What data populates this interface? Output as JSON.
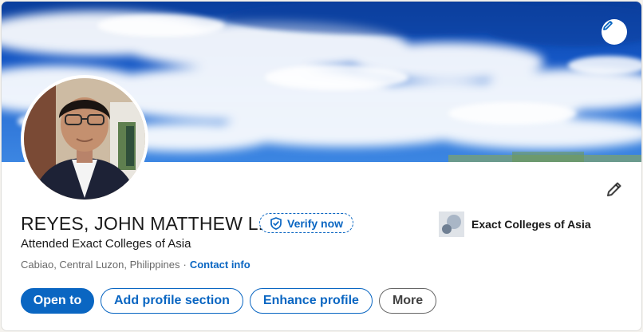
{
  "profile": {
    "name": "REYES, JOHN MATTHEW L.",
    "verify_label": "Verify now",
    "headline": "Attended Exact Colleges of Asia",
    "location": "Cabiao, Central Luzon, Philippines",
    "separator": "·",
    "contact_label": "Contact info"
  },
  "education": {
    "name": "Exact Colleges of Asia"
  },
  "actions": {
    "open_to": "Open to",
    "add_section": "Add profile section",
    "enhance": "Enhance profile",
    "more": "More"
  },
  "icons": {
    "edit_banner": "pencil-icon",
    "edit_intro": "pencil-icon",
    "verify": "shield-check-icon"
  },
  "colors": {
    "accent": "#0a66c2",
    "banner_sky": "#1456c4"
  }
}
